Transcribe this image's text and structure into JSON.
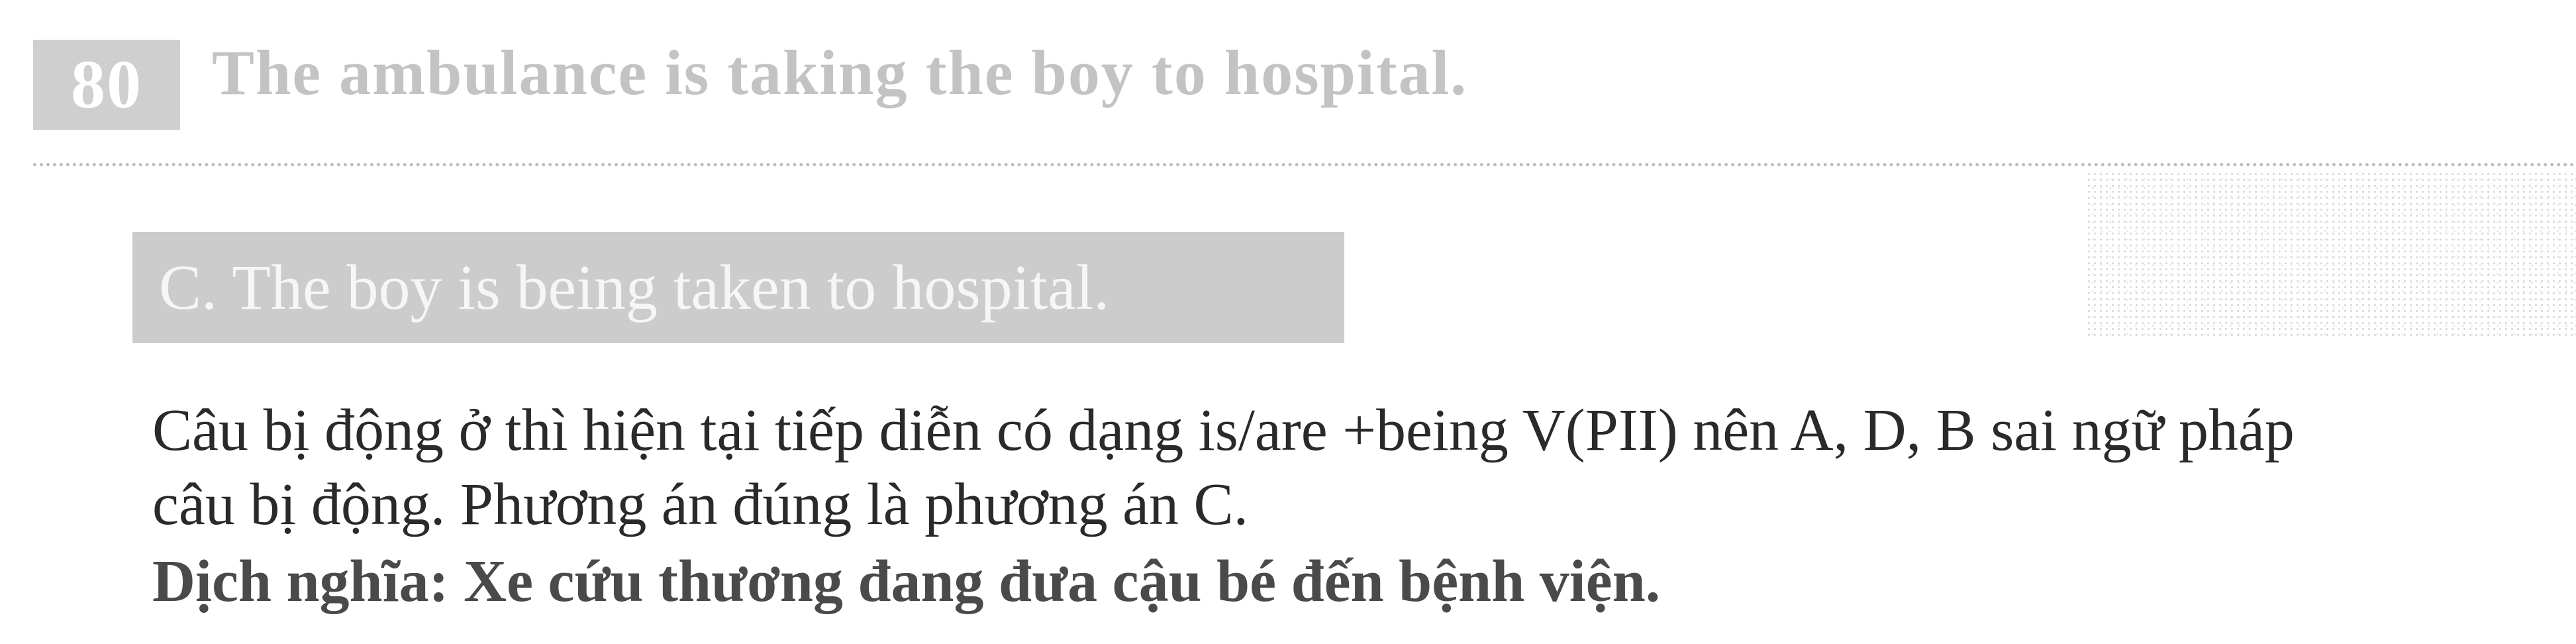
{
  "question": {
    "number": "80",
    "text": "The ambulance is taking the boy to hospital."
  },
  "answer": {
    "text": "C. The boy is being taken to hospital."
  },
  "explanation": {
    "line1": "Câu bị động ở thì hiện tại tiếp diễn có dạng is/are +being V(PII) nên A, D, B sai ngữ pháp",
    "line2": "câu bị động. Phương án đúng là phương án C."
  },
  "translation": {
    "text": "Dịch nghĩa: Xe cứu thương đang đưa cậu bé đến bệnh viện."
  }
}
